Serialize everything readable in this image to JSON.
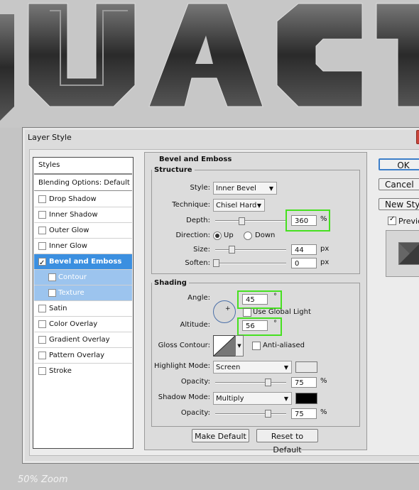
{
  "background": {
    "banner_text": "QUACK"
  },
  "zoom": {
    "label": "50% Zoom"
  },
  "dialog": {
    "title": "Layer Style"
  },
  "styles_list": {
    "header": "Styles",
    "blending": "Blending Options: Default",
    "items": [
      {
        "label": "Drop Shadow",
        "checked": false
      },
      {
        "label": "Inner Shadow",
        "checked": false
      },
      {
        "label": "Outer Glow",
        "checked": false
      },
      {
        "label": "Inner Glow",
        "checked": false
      },
      {
        "label": "Bevel and Emboss",
        "checked": true
      },
      {
        "label": "Contour",
        "checked": false
      },
      {
        "label": "Texture",
        "checked": false
      },
      {
        "label": "Satin",
        "checked": false
      },
      {
        "label": "Color Overlay",
        "checked": false
      },
      {
        "label": "Gradient Overlay",
        "checked": false
      },
      {
        "label": "Pattern Overlay",
        "checked": false
      },
      {
        "label": "Stroke",
        "checked": false
      }
    ]
  },
  "bevel": {
    "title": "Bevel and Emboss",
    "structure": {
      "title": "Structure",
      "style_label": "Style:",
      "style_value": "Inner Bevel",
      "technique_label": "Technique:",
      "technique_value": "Chisel Hard",
      "depth_label": "Depth:",
      "depth_value": "360",
      "depth_unit": "%",
      "direction_label": "Direction:",
      "dir_up": "Up",
      "dir_down": "Down",
      "size_label": "Size:",
      "size_value": "44",
      "size_unit": "px",
      "soften_label": "Soften:",
      "soften_value": "0",
      "soften_unit": "px"
    },
    "shading": {
      "title": "Shading",
      "angle_label": "Angle:",
      "angle_value": "45",
      "angle_unit": "°",
      "global_light": "Use Global Light",
      "altitude_label": "Altitude:",
      "altitude_value": "56",
      "altitude_unit": "°",
      "gloss_label": "Gloss Contour:",
      "anti_aliased": "Anti-aliased",
      "highlight_label": "Highlight Mode:",
      "highlight_value": "Screen",
      "highlight_color": "#e8e8e8",
      "hopacity_label": "Opacity:",
      "hopacity_value": "75",
      "hopacity_unit": "%",
      "shadow_label": "Shadow Mode:",
      "shadow_value": "Multiply",
      "shadow_color": "#000000",
      "sopacity_label": "Opacity:",
      "sopacity_value": "75",
      "sopacity_unit": "%"
    },
    "make_default": "Make Default",
    "reset_default": "Reset to Default"
  },
  "side": {
    "ok": "OK",
    "cancel": "Cancel",
    "new_style": "New Style...",
    "preview": "Preview"
  }
}
